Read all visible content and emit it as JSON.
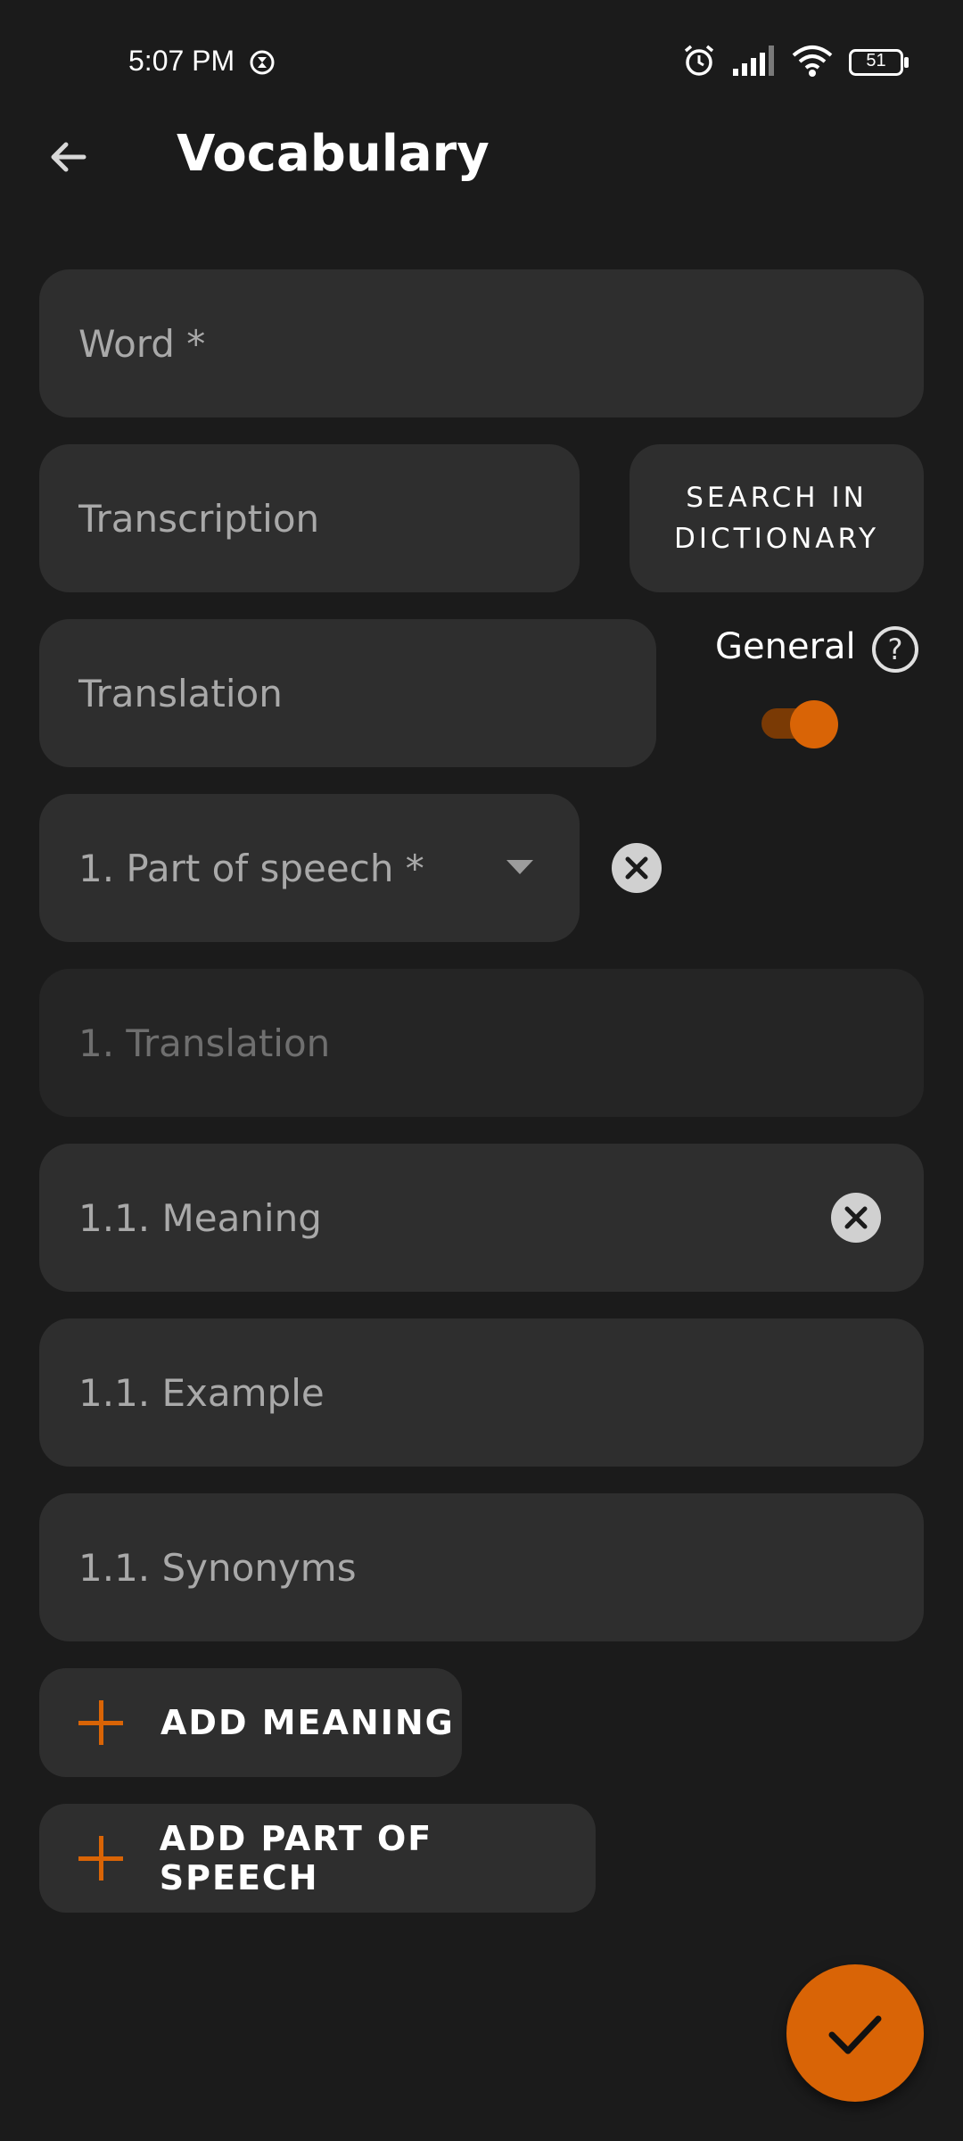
{
  "status_bar": {
    "time": "5:07 PM",
    "battery": "51",
    "icons": [
      "timer-icon",
      "alarm-icon",
      "signal-icon",
      "wifi-icon",
      "battery-icon"
    ]
  },
  "app_bar": {
    "back_icon": "arrow-back-icon",
    "title": "Vocabulary"
  },
  "form": {
    "word_placeholder": "Word *",
    "transcription_placeholder": "Transcription",
    "search_button_label": "SEARCH IN\nDICTIONARY",
    "translation_placeholder": "Translation",
    "general_label": "General",
    "general_toggle_on": true,
    "part_of_speech_placeholder": "1. Part of speech *",
    "pos_translation_placeholder": "1. Translation",
    "meaning_placeholder": "1.1. Meaning",
    "example_placeholder": "1.1. Example",
    "synonyms_placeholder": "1.1. Synonyms"
  },
  "actions": {
    "add_meaning_label": "ADD MEANING",
    "add_part_of_speech_label": "ADD PART OF SPEECH",
    "save_icon": "check-icon"
  },
  "colors": {
    "background": "#1b1b1b",
    "field": "#2e2e2e",
    "accent": "#d96406"
  }
}
